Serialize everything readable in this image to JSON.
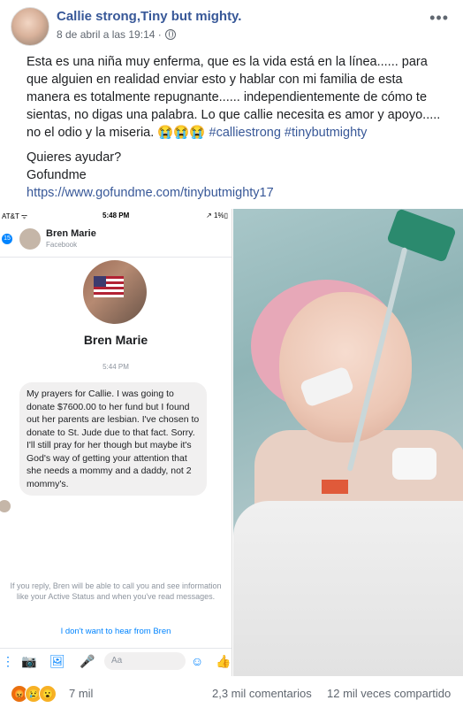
{
  "post": {
    "author": "Callie strong,Tiny but mighty.",
    "timestamp": "8 de abril a las 19:14 ·",
    "menu_glyph": "•••",
    "text_p1": "Esta es una niña muy enferma, que es la vida está en la línea...... para que alguien en realidad enviar esto y hablar con mi familia de esta manera es totalmente repugnante...... independientemente de cómo te sientas, no digas una palabra. Lo que callie necesita es amor y apoyo..... no el odio y la miseria.",
    "emojis": "😭😭😭",
    "hashtags": "#calliestrong #tinybutmighty",
    "help_line": "Quieres ayudar?",
    "gofundme_label": "Gofundme",
    "link": "https://www.gofundme.com/tinybutmighty17"
  },
  "messenger": {
    "carrier": "AT&T ᯤ",
    "time": "5:48 PM",
    "battery": "↗ 1%▯",
    "back_badge": "15",
    "contact_name": "Bren Marie",
    "contact_sub": "Facebook",
    "profile_name": "Bren Marie",
    "message_time": "5:44 PM",
    "message": "My prayers for Callie. I was going to donate $7600.00 to her fund but I found out her parents are lesbian. I've chosen to donate to St. Jude due to that fact. Sorry. I'll still pray for her though but maybe it's God's way of getting your attention that she needs a mommy and a daddy, not 2 mommy's.",
    "notice": "If you reply, Bren will be able to call you and see information like your Active Status and when you've read messages.",
    "notice_link": "I don't want to hear from Bren",
    "composer_placeholder": "Aa"
  },
  "footer": {
    "reactions_count": "7 mil",
    "comments": "2,3 mil comentarios",
    "shares": "12 mil veces compartido"
  },
  "colors": {
    "link_blue": "#385898",
    "messenger_blue": "#0084ff"
  }
}
